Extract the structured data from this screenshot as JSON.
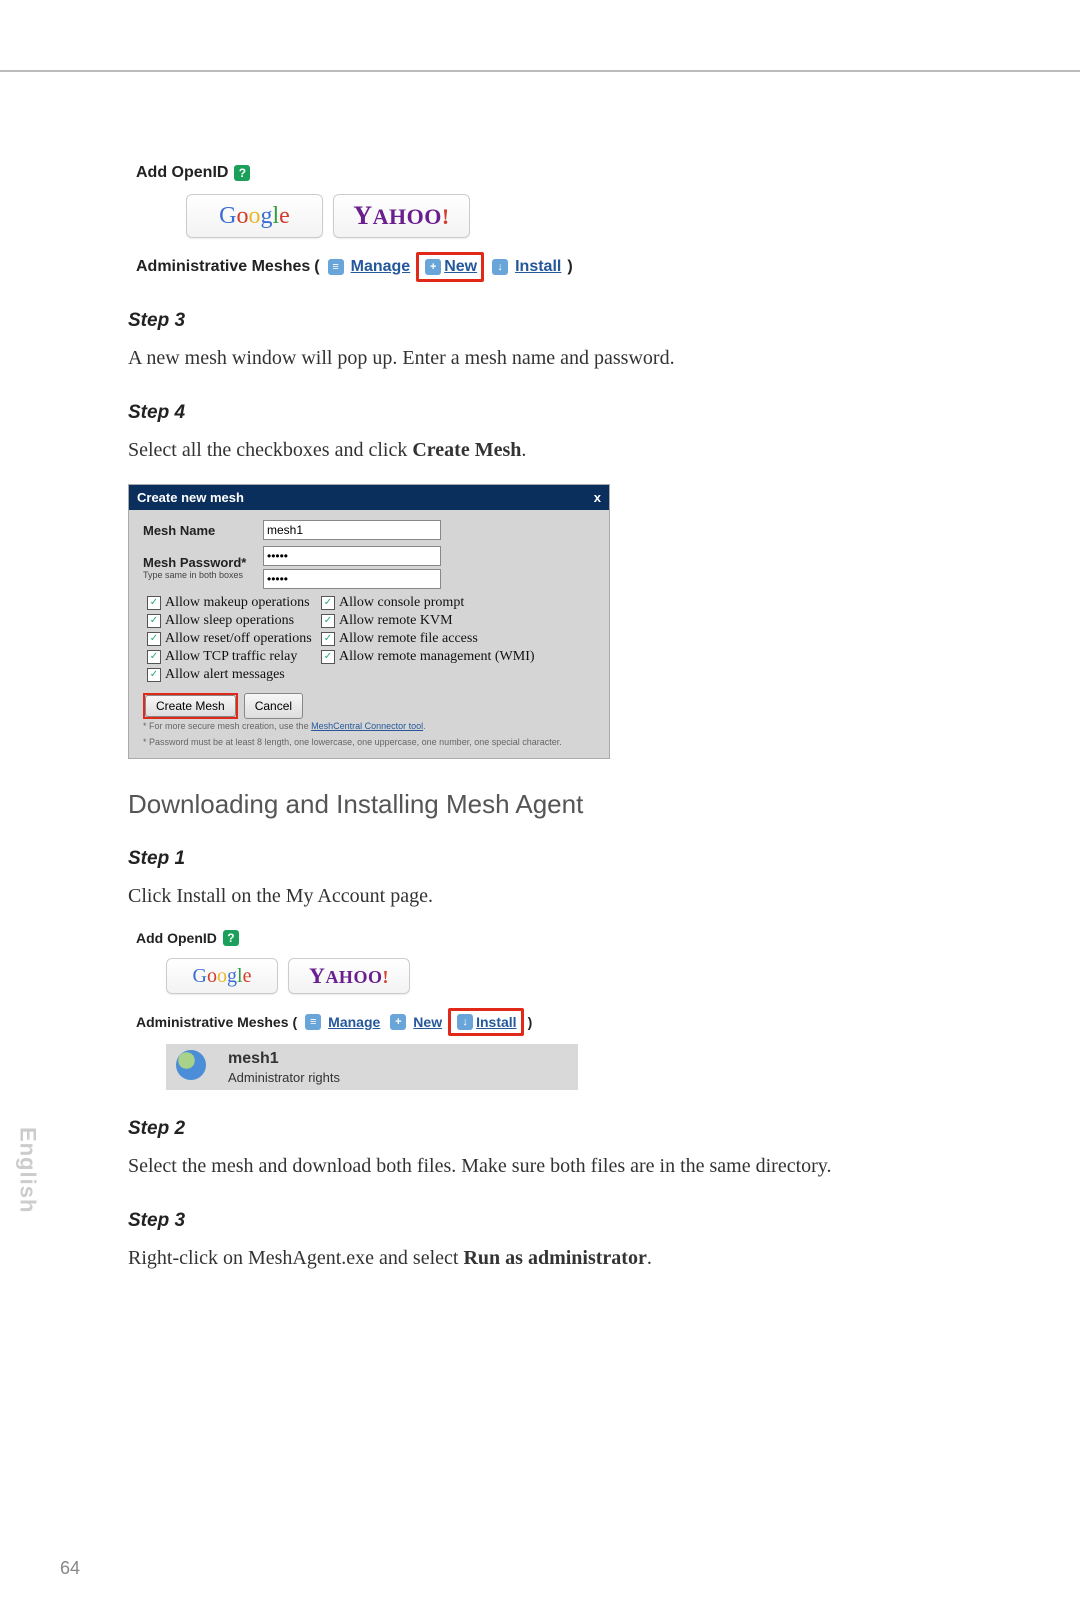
{
  "side_tab": "English",
  "page_number": "64",
  "openid": {
    "label": "Add OpenID",
    "help_glyph": "?",
    "google_letters": [
      "G",
      "o",
      "o",
      "g",
      "l",
      "e"
    ],
    "yahoo_text": "YAHOO!"
  },
  "admin_meshes": {
    "prefix": "Administrative Meshes",
    "paren_open": "(",
    "paren_close": ")",
    "manage_label": "Manage",
    "new_label": "New",
    "install_label": "Install",
    "manage_icon_glyph": "≡",
    "new_icon_glyph": "+",
    "install_icon_glyph": "↓"
  },
  "step3a_title": "Step 3",
  "step3a_body": "A new mesh window will pop up. Enter a mesh name and password.",
  "step4_title": "Step 4",
  "step4_body_pre": "Select all the checkboxes and click ",
  "step4_body_bold": "Create Mesh",
  "step4_body_post": ".",
  "dialog": {
    "title": "Create new mesh",
    "close": "x",
    "name_label": "Mesh Name",
    "name_value": "mesh1",
    "pwd_label": "Mesh Password*",
    "pwd_hint": "Type same in both boxes",
    "pwd_value": "•••••",
    "pwd_value2": "•••••",
    "checks": {
      "makeup": "Allow makeup operations",
      "console": "Allow console prompt",
      "sleep": "Allow sleep operations",
      "kvm": "Allow remote KVM",
      "reset": "Allow reset/off operations",
      "file": "Allow remote file access",
      "tcp": "Allow TCP traffic relay",
      "wmi": "Allow remote management (WMI)",
      "alert": "Allow alert messages"
    },
    "create_btn": "Create Mesh",
    "cancel_btn": "Cancel",
    "fine1_pre": "* For more secure mesh creation, use the ",
    "fine1_link": "MeshCentral Connector tool",
    "fine1_post": ".",
    "fine2": "* Password must be at least 8 length, one lowercase, one uppercase, one number, one special character."
  },
  "h2_download": "Downloading and Installing Mesh Agent",
  "step1_title": "Step 1",
  "step1_body": "Click Install on the My Account page.",
  "mesh_row": {
    "title": "mesh1",
    "sub": "Administrator rights"
  },
  "step2_title": "Step 2",
  "step2_body": "Select the mesh and download both files. Make sure both files are in the same directory.",
  "step3b_title": "Step 3",
  "step3b_body_pre": "Right-click on MeshAgent.exe and select ",
  "step3b_body_bold": "Run as administrator",
  "step3b_body_post": "."
}
